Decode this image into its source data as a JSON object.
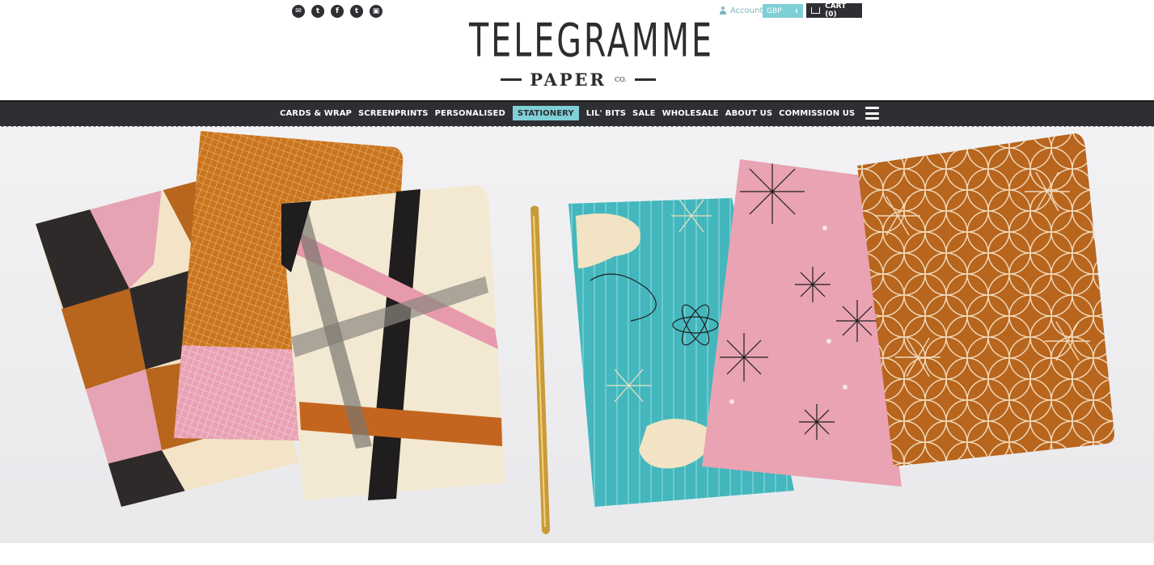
{
  "header": {
    "social_icons": [
      {
        "name": "email-icon",
        "glyph": "✉"
      },
      {
        "name": "twitter-icon",
        "glyph": "t"
      },
      {
        "name": "facebook-icon",
        "glyph": "f"
      },
      {
        "name": "tumblr-icon",
        "glyph": "t"
      },
      {
        "name": "instagram-icon",
        "glyph": "▣"
      }
    ],
    "logo": {
      "main": "TELEGRAMME",
      "sub": "PAPER",
      "co": "CO."
    },
    "account_label": "Account",
    "currency": "GBP",
    "cart_label": "CART (0)"
  },
  "nav": {
    "items": [
      {
        "label": "CARDS & WRAP",
        "active": false
      },
      {
        "label": "SCREENPRINTS",
        "active": false
      },
      {
        "label": "PERSONALISED",
        "active": false
      },
      {
        "label": "STATIONERY",
        "active": true
      },
      {
        "label": "LIL' BITS",
        "active": false
      },
      {
        "label": "SALE",
        "active": false
      },
      {
        "label": "WHOLESALE",
        "active": false
      },
      {
        "label": "ABOUT US",
        "active": false
      },
      {
        "label": "COMMISSION US",
        "active": false
      }
    ]
  },
  "colors": {
    "nav_bg": "#2e2f33",
    "accent": "#7ecfd6",
    "account_text": "#7fb6c0"
  }
}
